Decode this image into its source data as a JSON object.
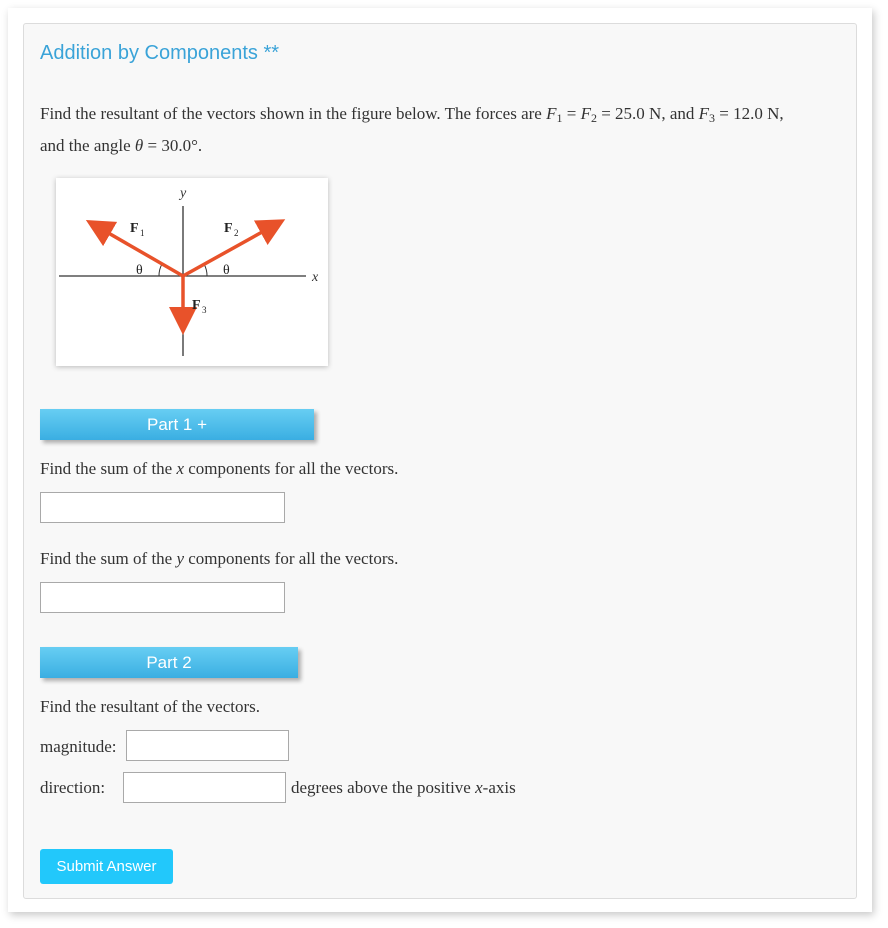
{
  "title": "Addition by Components **",
  "problem": {
    "line1_prefix": "Find the resultant of the vectors shown in the figure below. The forces are ",
    "f1": "F",
    "f1_sub": "1",
    "eq1": " = ",
    "f2": "F",
    "f2_sub": "2",
    "eq2": " = 25.0 N, and ",
    "f3": "F",
    "f3_sub": "3",
    "eq3": " = 12.0 N,",
    "line2_prefix": "and the angle ",
    "theta": "θ",
    "line2_suffix": " = 30.0°."
  },
  "figure": {
    "y_label": "y",
    "x_label": "x",
    "f1_label": "F",
    "f1_sub": "1",
    "f2_label": "F",
    "f2_sub": "2",
    "f3_label": "F",
    "f3_sub": "3",
    "theta_left": "θ",
    "theta_right": "θ",
    "vector_color": "#e8522a"
  },
  "part1": {
    "button_label": "Part 1 +",
    "q1_prefix": "Find the sum of the ",
    "q1_var": "x",
    "q1_suffix": " components for all the vectors.",
    "q1_value": "",
    "q2_prefix": "Find the sum of the ",
    "q2_var": "y",
    "q2_suffix": " components for all the vectors.",
    "q2_value": ""
  },
  "part2": {
    "button_label": "Part 2",
    "question": "Find the resultant of the vectors.",
    "magnitude_label": "magnitude:",
    "magnitude_value": "",
    "direction_label": "direction:",
    "direction_value": "",
    "direction_suffix_prefix": "degrees above the positive ",
    "direction_suffix_var": "x",
    "direction_suffix_end": "-axis"
  },
  "submit_label": "Submit Answer",
  "colors": {
    "title": "#3aa3d8",
    "part_button": "#4cbdeb",
    "submit_button": "#22c8fb"
  }
}
